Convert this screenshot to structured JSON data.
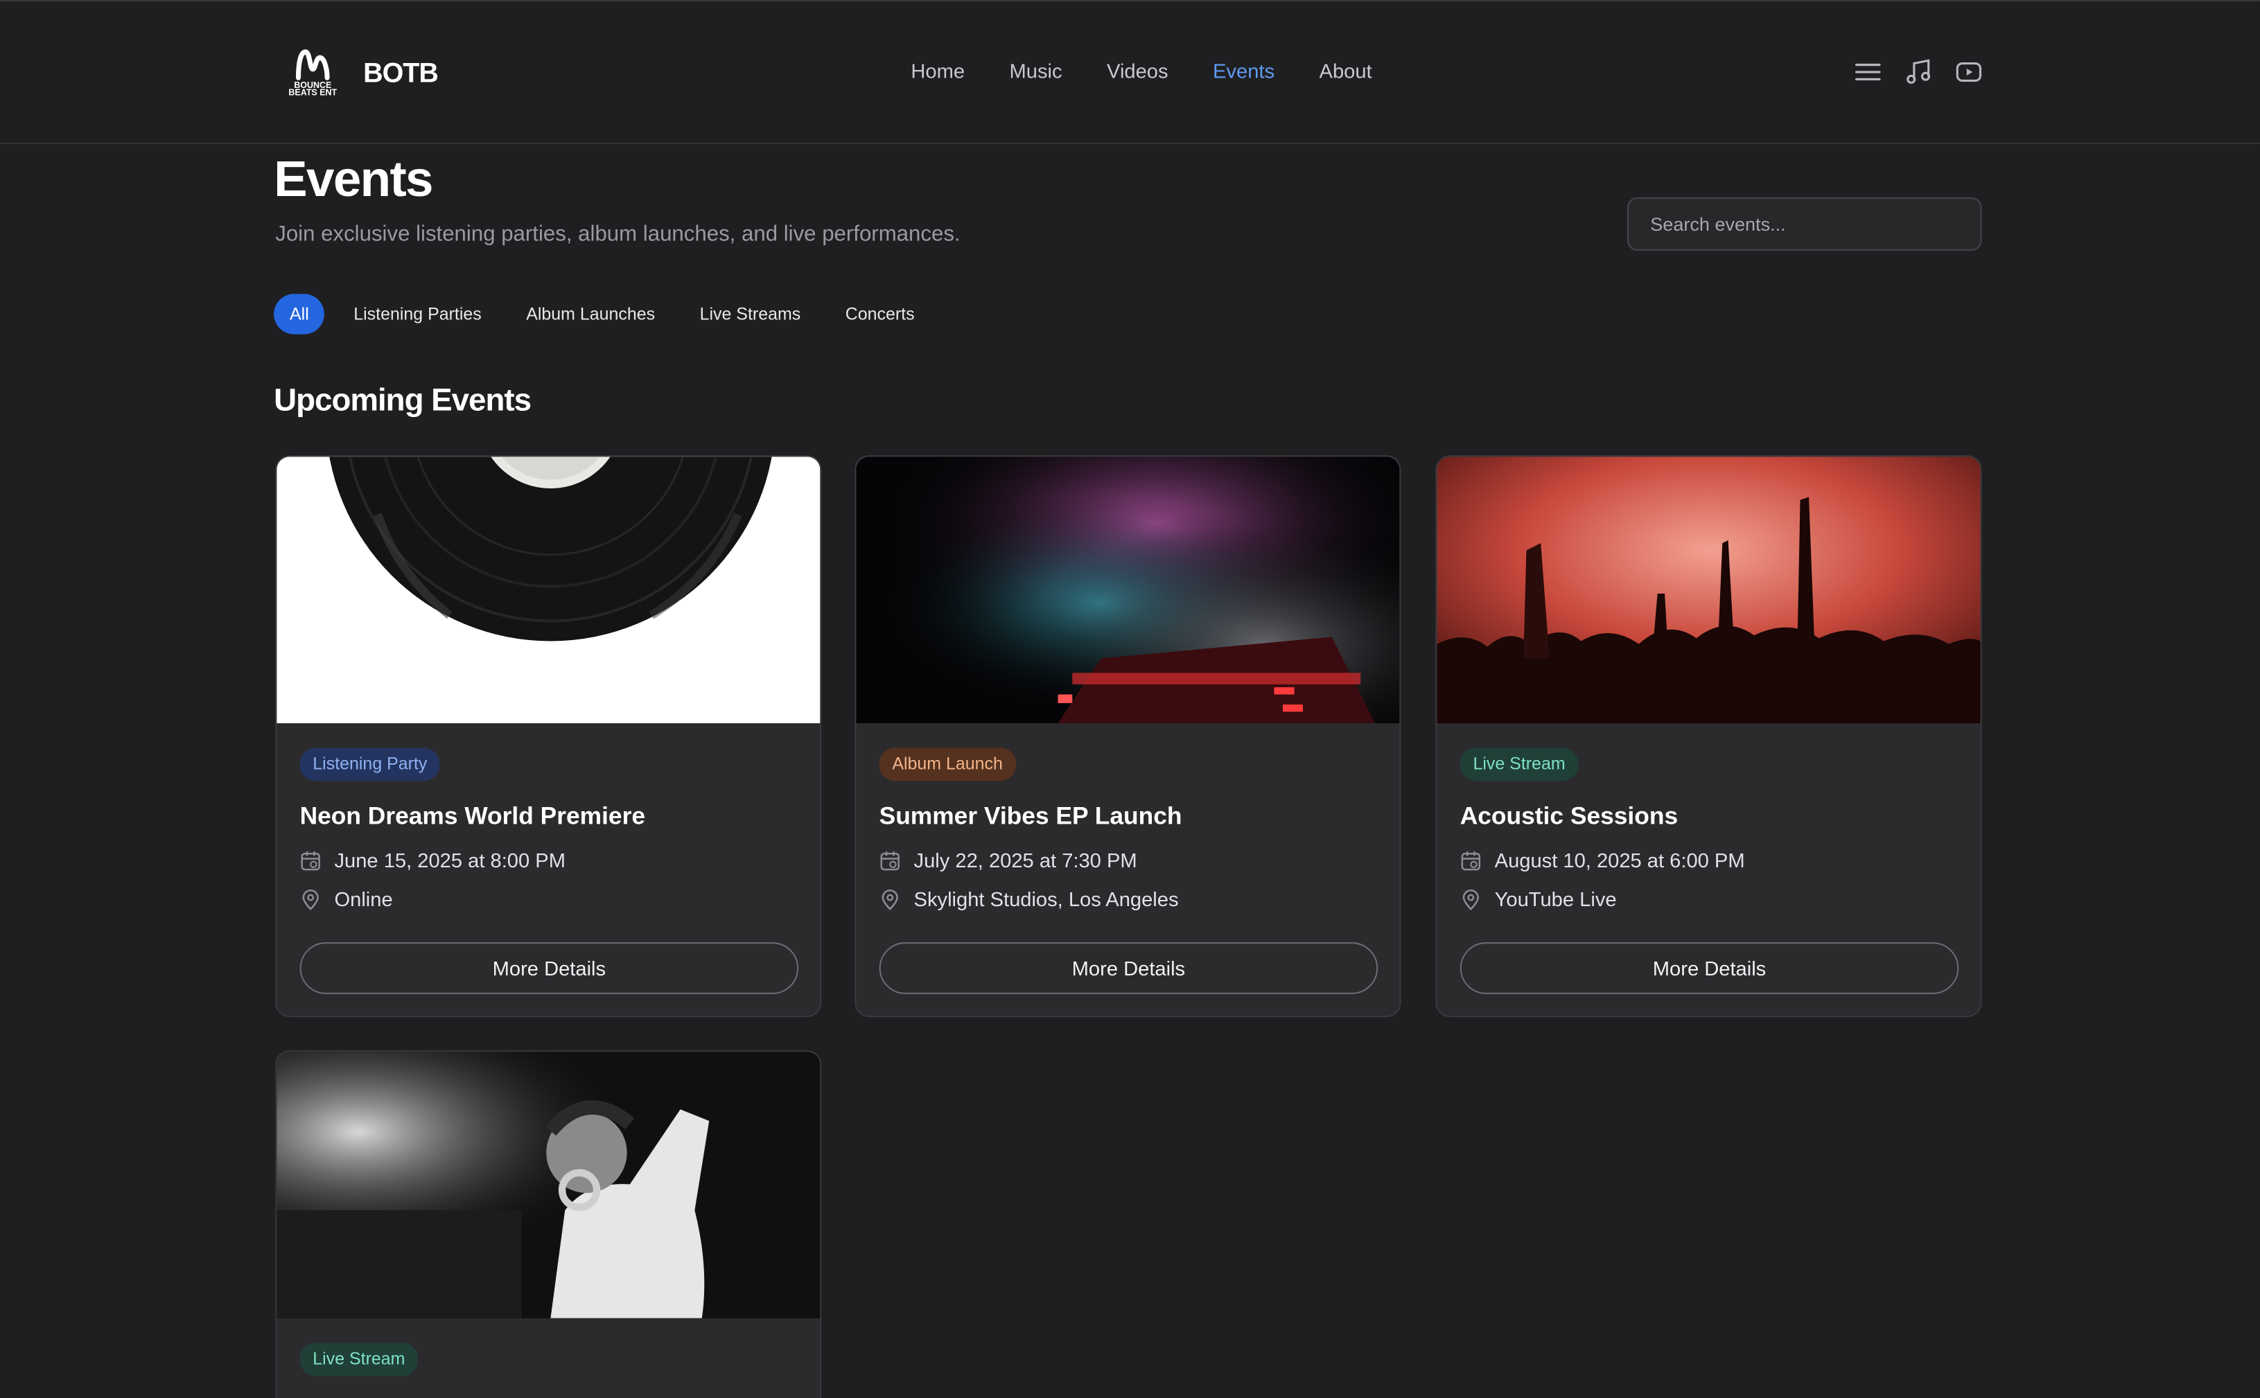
{
  "brand": {
    "logo_text": "BOUNCE BEATS ENT",
    "name": "BOTB"
  },
  "nav": [
    "Home",
    "Music",
    "Videos",
    "Events",
    "About"
  ],
  "nav_active": "Events",
  "header_icons": [
    "menu-icon",
    "music-note-icon",
    "youtube-play-icon"
  ],
  "page": {
    "title": "Events",
    "subtitle": "Join exclusive listening parties, album launches, and live performances."
  },
  "search": {
    "placeholder": "Search events...",
    "value": ""
  },
  "filters": [
    "All",
    "Listening Parties",
    "Album Launches",
    "Live Streams",
    "Concerts"
  ],
  "filter_active": "All",
  "section_title": "Upcoming Events",
  "events": [
    {
      "badge": "Listening Party",
      "badge_color": "#8fb1f2",
      "title": "Neon Dreams World Premiere",
      "date": "June 15, 2025 at 8:00 PM",
      "location": "Online",
      "button": "More Details",
      "image": "vinyl-record-image"
    },
    {
      "badge": "Album Launch",
      "badge_color": "#f2b48a",
      "title": "Summer Vibes EP Launch",
      "date": "July 22, 2025 at 7:30 PM",
      "location": "Skylight Studios, Los Angeles",
      "button": "More Details",
      "image": "fireworks-stage-image"
    },
    {
      "badge": "Live Stream",
      "badge_color": "#7fe2c3",
      "title": "Acoustic Sessions",
      "date": "August 10, 2025 at 6:00 PM",
      "location": "YouTube Live",
      "button": "More Details",
      "image": "concert-crowd-image"
    },
    {
      "badge": "Live Stream",
      "badge_color": "#7fe2c3",
      "image": "dj-performer-image"
    }
  ],
  "colors": {
    "accent": "#2466e0",
    "nav_active": "#5f9bf0",
    "background": "#1f1f21",
    "card": "#2b2b2e"
  }
}
